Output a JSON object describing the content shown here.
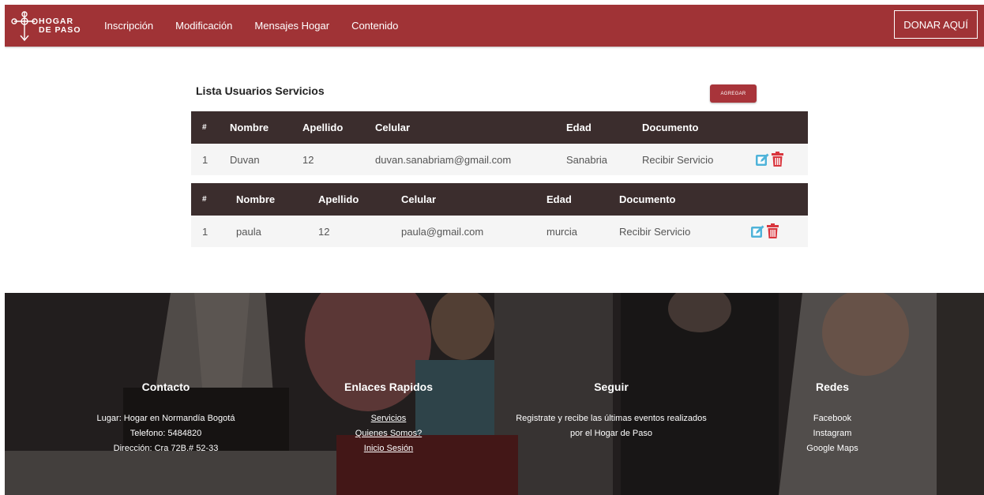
{
  "navbar": {
    "brand": {
      "line1": "HOGAR",
      "line2": "DE PASO"
    },
    "links": [
      "Inscripción",
      "Modificación",
      "Mensajes Hogar",
      "Contenido"
    ],
    "donate_label": "DONAR AQUÍ"
  },
  "main": {
    "title": "Lista Usuarios Servicios",
    "add_label": "AGREGAR",
    "tables": [
      {
        "headers": [
          "#",
          "Nombre",
          "Apellido",
          "Celular",
          "Edad",
          "Documento"
        ],
        "rows": [
          {
            "num": "1",
            "nombre": "Duvan",
            "apellido": "12",
            "celular": "duvan.sanabriam@gmail.com",
            "edad": "Sanabria",
            "documento": "Recibir Servicio"
          }
        ]
      },
      {
        "headers": [
          "#",
          "Nombre",
          "Apellido",
          "Celular",
          "Edad",
          "Documento"
        ],
        "rows": [
          {
            "num": "1",
            "nombre": "paula",
            "apellido": "12",
            "celular": "paula@gmail.com",
            "edad": "murcia",
            "documento": "Recibir Servicio"
          }
        ]
      }
    ]
  },
  "footer": {
    "contacto": {
      "title": "Contacto",
      "lines": [
        "Lugar: Hogar en Normandía Bogotá",
        "Telefono: 5484820",
        "Dirección: Cra 72B.# 52-33"
      ]
    },
    "enlaces": {
      "title": "Enlaces Rapidos",
      "links": [
        "Servicios",
        "Quienes Somos?",
        "Inicio Sesión"
      ]
    },
    "seguir": {
      "title": "Seguir",
      "lines": [
        "Registrate y recibe las últimas eventos realizados",
        "por el Hogar de Paso"
      ]
    },
    "redes": {
      "title": "Redes",
      "links": [
        "Facebook",
        "Instagram",
        "Google Maps"
      ]
    }
  },
  "colors": {
    "navbar": "#a03336",
    "table_header": "#3b2d2d",
    "row_bg": "#f5f5f5",
    "edit_icon": "#4fb3d9",
    "delete_icon": "#d9363e"
  },
  "icons": {
    "edit": "edit-icon",
    "delete": "trash-icon",
    "brand": "cross-logo-icon"
  }
}
